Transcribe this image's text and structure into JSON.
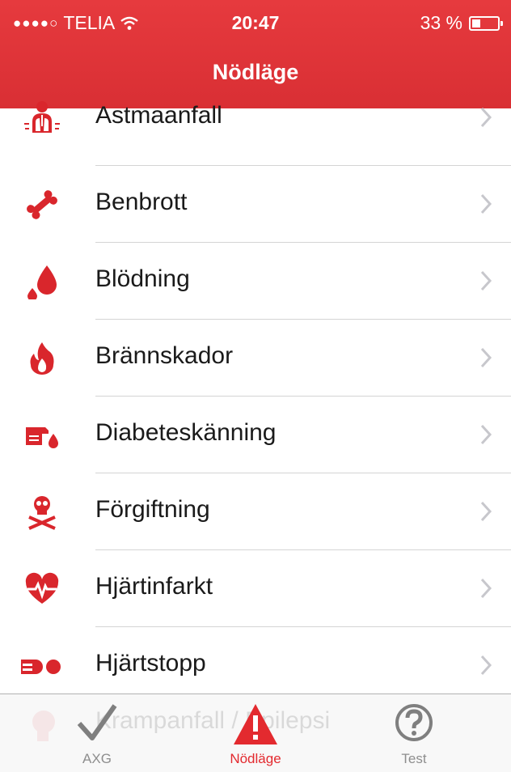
{
  "status_bar": {
    "signal_dots": "●●●●○",
    "carrier": "TELIA",
    "time": "20:47",
    "battery": "33 %",
    "battery_level": 0.33
  },
  "nav": {
    "title": "Nödläge"
  },
  "accent_color": "#e32a2f",
  "items": [
    {
      "label": "Astmaanfall",
      "icon": "lungs-icon"
    },
    {
      "label": "Benbrott",
      "icon": "bone-icon"
    },
    {
      "label": "Blödning",
      "icon": "blood-drop-icon"
    },
    {
      "label": "Brännskador",
      "icon": "flame-icon"
    },
    {
      "label": "Diabeteskänning",
      "icon": "finger-prick-icon"
    },
    {
      "label": "Förgiftning",
      "icon": "skull-crossbones-icon"
    },
    {
      "label": "Hjärtinfarkt",
      "icon": "heart-pulse-icon"
    },
    {
      "label": "Hjärtstopp",
      "icon": "heart-stop-icon"
    }
  ],
  "partial_item": {
    "label": "Krampanfall / Epilepsi",
    "icon": "head-icon"
  },
  "tabs": [
    {
      "label": "AXG",
      "icon": "checkmark-icon",
      "active": false
    },
    {
      "label": "Nödläge",
      "icon": "warning-icon",
      "active": true
    },
    {
      "label": "Test",
      "icon": "question-icon",
      "active": false
    }
  ]
}
